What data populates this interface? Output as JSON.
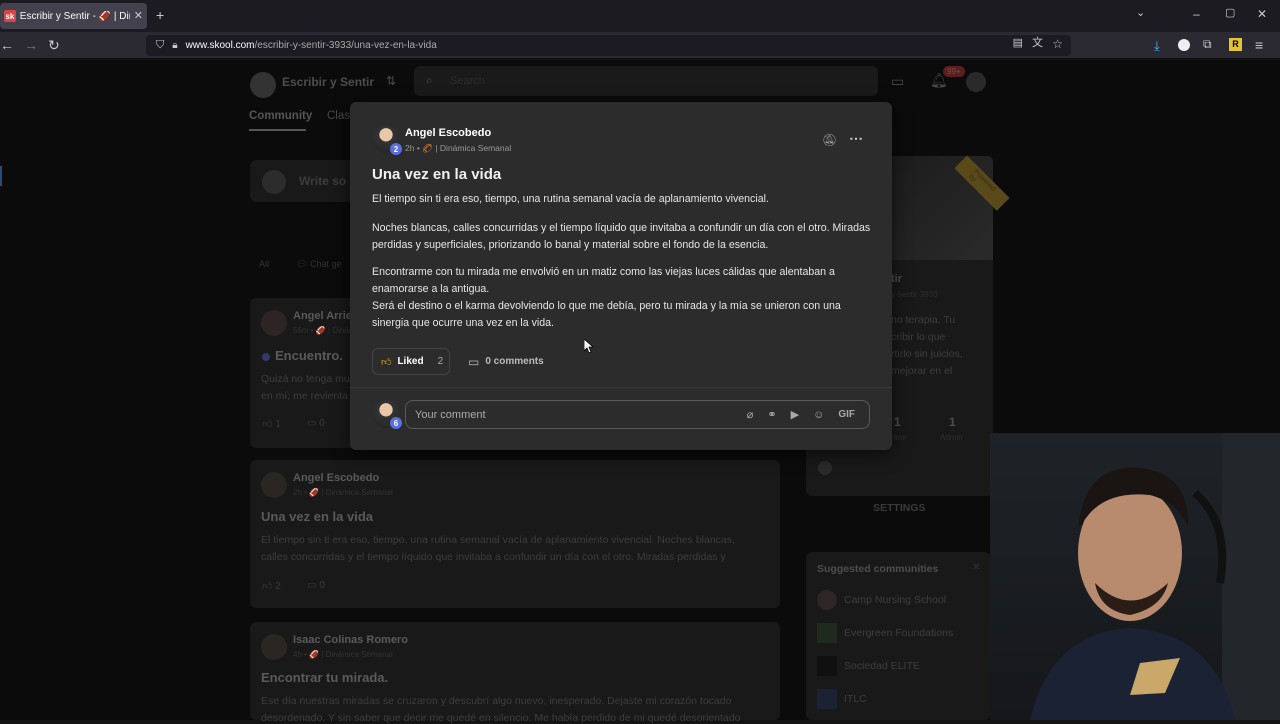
{
  "browser": {
    "tab_title": "Escribir y Sentir - 🏈 | Dinámica",
    "favicon_text": "sk",
    "url_domain": "www.skool.com",
    "url_path": "/escribir-y-sentir-3933/una-vez-en-la-vida"
  },
  "header": {
    "group_name": "Escribir y Sentir",
    "search_placeholder": "Search",
    "notif_count": "99+",
    "nav_community": "Community",
    "nav_classroom": "Class",
    "write_placeholder": "Write so",
    "filter_all": "All",
    "filter_chat": "Chat ge"
  },
  "feed": {
    "posts": [
      {
        "author": "Angel Arrie",
        "meta": "56m • 🏈 | Dinámica",
        "title": "Encuentro.",
        "excerpt": "Quizá no tenga mu",
        "excerpt2": "en mí; me revienta",
        "likes": "1",
        "comments": "0"
      },
      {
        "author": "Angel Escobedo",
        "meta": "2h • 🏈 | Dinámica Semanal",
        "title": "Una vez en la vida",
        "excerpt": "El tiempo sin ti era eso, tiempo, una rutina semanal vacía de aplanamiento vivencial. Noches blancas,",
        "excerpt2": "calles concurridas y el tiempo líquido que invitaba a confundir un día con el otro. Miradas perdidas y",
        "likes": "2",
        "comments": "0"
      },
      {
        "author": "Isaac Colinas Romero",
        "meta": "4h • 🏈 | Dinámica Semanal",
        "title": "Encontrar tu mirada.",
        "excerpt": "Ese día nuestras miradas se cruzaron y descubrí algo nuevo, inesperado. Dejaste mi corazón tocado",
        "excerpt2": "desordenado. Y sin saber que decir me quedé en silencio. Me había perdido de mi quedé desorientado"
      }
    ]
  },
  "sidebar": {
    "group_title": "tir",
    "group_url": "y-sentir-3933",
    "desc": [
      "no terapia. Tu",
      "cribir lo que",
      "rtirlo sin juicios,",
      "mejorar en el"
    ],
    "stat1": "1",
    "stat2": "1",
    "stat1_label": "line",
    "stat2_label": "Admin",
    "settings": "SETTINGS",
    "suggested_title": "Suggested communities",
    "suggested": [
      "Camp Nursing School",
      "Evergreen Foundations",
      "Sociedad ELITE",
      "ITLC"
    ],
    "ribbon": "Powered by"
  },
  "modal": {
    "author": "Angel Escobedo",
    "level": "2",
    "time": "2h",
    "category": "| Dinámica Semanal",
    "title": "Una vez en la vida",
    "paragraphs": [
      "El tiempo sin ti era eso, tiempo, una rutina semanal vacía de aplanamiento vivencial.",
      "Noches blancas, calles concurridas y el tiempo líquido que invitaba a confundir un día con el otro. Miradas perdidas y superficiales, priorizando lo banal y material sobre el fondo de la esencia.",
      "Encontrarme con tu mirada me envolvió en un matiz como las viejas luces cálidas que alentaban a enamorarse a la antigua.",
      "Será el destino o el karma devolviendo lo que me debía, pero tu mirada y la mía se unieron con una sinergia que ocurre una vez en la vida."
    ],
    "liked_label": "Liked",
    "like_count": "2",
    "comments_label": "0 comments",
    "comment_placeholder": "Your comment",
    "gif_label": "GIF",
    "my_level": "6"
  }
}
